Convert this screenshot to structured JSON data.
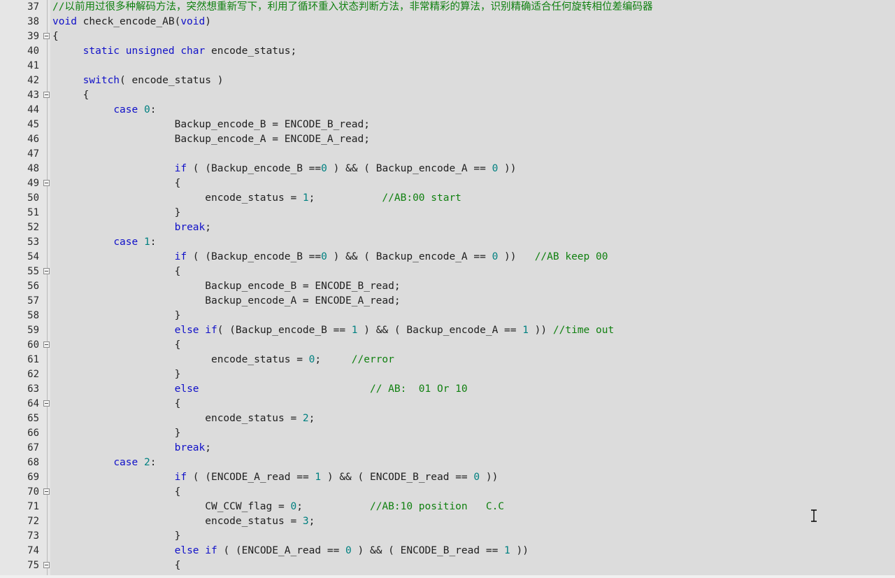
{
  "editor": {
    "lines": [
      {
        "num": "37",
        "fold": false,
        "tokens": [
          {
            "t": "//以前用过很多种解码方法，突然想重新写下，利用了循环重入状态判断方法，非常精彩的算法，识别精确适合任何旋转相位差编码器",
            "c": "cmt"
          }
        ]
      },
      {
        "num": "38",
        "fold": false,
        "tokens": [
          {
            "t": "void",
            "c": "kw"
          },
          {
            "t": " check_encode_AB(",
            "c": "plain"
          },
          {
            "t": "void",
            "c": "kw"
          },
          {
            "t": ")",
            "c": "plain"
          }
        ]
      },
      {
        "num": "39",
        "fold": true,
        "tokens": [
          {
            "t": "{",
            "c": "plain"
          }
        ]
      },
      {
        "num": "40",
        "fold": false,
        "tokens": [
          {
            "t": "     ",
            "c": "plain"
          },
          {
            "t": "static unsigned char",
            "c": "kw"
          },
          {
            "t": " encode_status;",
            "c": "plain"
          }
        ]
      },
      {
        "num": "41",
        "fold": false,
        "tokens": []
      },
      {
        "num": "42",
        "fold": false,
        "tokens": [
          {
            "t": "     ",
            "c": "plain"
          },
          {
            "t": "switch",
            "c": "kw"
          },
          {
            "t": "( encode_status )",
            "c": "plain"
          }
        ]
      },
      {
        "num": "43",
        "fold": true,
        "tokens": [
          {
            "t": "     {",
            "c": "plain"
          }
        ]
      },
      {
        "num": "44",
        "fold": false,
        "tokens": [
          {
            "t": "          ",
            "c": "plain"
          },
          {
            "t": "case",
            "c": "kw"
          },
          {
            "t": " ",
            "c": "plain"
          },
          {
            "t": "0",
            "c": "num"
          },
          {
            "t": ":",
            "c": "plain"
          }
        ]
      },
      {
        "num": "45",
        "fold": false,
        "tokens": [
          {
            "t": "                    Backup_encode_B = ENCODE_B_read;",
            "c": "plain"
          }
        ]
      },
      {
        "num": "46",
        "fold": false,
        "tokens": [
          {
            "t": "                    Backup_encode_A = ENCODE_A_read;",
            "c": "plain"
          }
        ]
      },
      {
        "num": "47",
        "fold": false,
        "tokens": []
      },
      {
        "num": "48",
        "fold": false,
        "tokens": [
          {
            "t": "                    ",
            "c": "plain"
          },
          {
            "t": "if",
            "c": "kw"
          },
          {
            "t": " ( (Backup_encode_B ==",
            "c": "plain"
          },
          {
            "t": "0",
            "c": "num"
          },
          {
            "t": " ) && ( Backup_encode_A == ",
            "c": "plain"
          },
          {
            "t": "0",
            "c": "num"
          },
          {
            "t": " ))",
            "c": "plain"
          }
        ]
      },
      {
        "num": "49",
        "fold": true,
        "tokens": [
          {
            "t": "                    {",
            "c": "plain"
          }
        ]
      },
      {
        "num": "50",
        "fold": false,
        "tokens": [
          {
            "t": "                         encode_status = ",
            "c": "plain"
          },
          {
            "t": "1",
            "c": "num"
          },
          {
            "t": ";           ",
            "c": "plain"
          },
          {
            "t": "//AB:00 start",
            "c": "cmt"
          }
        ]
      },
      {
        "num": "51",
        "fold": false,
        "tokens": [
          {
            "t": "                    }",
            "c": "plain"
          }
        ]
      },
      {
        "num": "52",
        "fold": false,
        "tokens": [
          {
            "t": "                    ",
            "c": "plain"
          },
          {
            "t": "break",
            "c": "kw"
          },
          {
            "t": ";",
            "c": "plain"
          }
        ]
      },
      {
        "num": "53",
        "fold": false,
        "tokens": [
          {
            "t": "          ",
            "c": "plain"
          },
          {
            "t": "case",
            "c": "kw"
          },
          {
            "t": " ",
            "c": "plain"
          },
          {
            "t": "1",
            "c": "num"
          },
          {
            "t": ":",
            "c": "plain"
          }
        ]
      },
      {
        "num": "54",
        "fold": false,
        "tokens": [
          {
            "t": "                    ",
            "c": "plain"
          },
          {
            "t": "if",
            "c": "kw"
          },
          {
            "t": " ( (Backup_encode_B ==",
            "c": "plain"
          },
          {
            "t": "0",
            "c": "num"
          },
          {
            "t": " ) && ( Backup_encode_A == ",
            "c": "plain"
          },
          {
            "t": "0",
            "c": "num"
          },
          {
            "t": " ))   ",
            "c": "plain"
          },
          {
            "t": "//AB keep 00",
            "c": "cmt"
          }
        ]
      },
      {
        "num": "55",
        "fold": true,
        "tokens": [
          {
            "t": "                    {",
            "c": "plain"
          }
        ]
      },
      {
        "num": "56",
        "fold": false,
        "tokens": [
          {
            "t": "                         Backup_encode_B = ENCODE_B_read;",
            "c": "plain"
          }
        ]
      },
      {
        "num": "57",
        "fold": false,
        "tokens": [
          {
            "t": "                         Backup_encode_A = ENCODE_A_read;",
            "c": "plain"
          }
        ]
      },
      {
        "num": "58",
        "fold": false,
        "tokens": [
          {
            "t": "                    }",
            "c": "plain"
          }
        ]
      },
      {
        "num": "59",
        "fold": false,
        "tokens": [
          {
            "t": "                    ",
            "c": "plain"
          },
          {
            "t": "else if",
            "c": "kw"
          },
          {
            "t": "( (Backup_encode_B == ",
            "c": "plain"
          },
          {
            "t": "1",
            "c": "num"
          },
          {
            "t": " ) && ( Backup_encode_A == ",
            "c": "plain"
          },
          {
            "t": "1",
            "c": "num"
          },
          {
            "t": " )) ",
            "c": "plain"
          },
          {
            "t": "//time out",
            "c": "cmt"
          }
        ]
      },
      {
        "num": "60",
        "fold": true,
        "tokens": [
          {
            "t": "                    {",
            "c": "plain"
          }
        ]
      },
      {
        "num": "61",
        "fold": false,
        "tokens": [
          {
            "t": "                          encode_status = ",
            "c": "plain"
          },
          {
            "t": "0",
            "c": "num"
          },
          {
            "t": ";     ",
            "c": "plain"
          },
          {
            "t": "//error",
            "c": "cmt"
          }
        ]
      },
      {
        "num": "62",
        "fold": false,
        "tokens": [
          {
            "t": "                    }",
            "c": "plain"
          }
        ]
      },
      {
        "num": "63",
        "fold": false,
        "tokens": [
          {
            "t": "                    ",
            "c": "plain"
          },
          {
            "t": "else",
            "c": "kw"
          },
          {
            "t": "                            ",
            "c": "plain"
          },
          {
            "t": "// AB:  01 Or 10",
            "c": "cmt"
          }
        ]
      },
      {
        "num": "64",
        "fold": true,
        "tokens": [
          {
            "t": "                    {",
            "c": "plain"
          }
        ]
      },
      {
        "num": "65",
        "fold": false,
        "tokens": [
          {
            "t": "                         encode_status = ",
            "c": "plain"
          },
          {
            "t": "2",
            "c": "num"
          },
          {
            "t": ";",
            "c": "plain"
          }
        ]
      },
      {
        "num": "66",
        "fold": false,
        "tokens": [
          {
            "t": "                    }",
            "c": "plain"
          }
        ]
      },
      {
        "num": "67",
        "fold": false,
        "tokens": [
          {
            "t": "                    ",
            "c": "plain"
          },
          {
            "t": "break",
            "c": "kw"
          },
          {
            "t": ";",
            "c": "plain"
          }
        ]
      },
      {
        "num": "68",
        "fold": false,
        "tokens": [
          {
            "t": "          ",
            "c": "plain"
          },
          {
            "t": "case",
            "c": "kw"
          },
          {
            "t": " ",
            "c": "plain"
          },
          {
            "t": "2",
            "c": "num"
          },
          {
            "t": ":",
            "c": "plain"
          }
        ]
      },
      {
        "num": "69",
        "fold": false,
        "tokens": [
          {
            "t": "                    ",
            "c": "plain"
          },
          {
            "t": "if",
            "c": "kw"
          },
          {
            "t": " ( (ENCODE_A_read == ",
            "c": "plain"
          },
          {
            "t": "1",
            "c": "num"
          },
          {
            "t": " ) && ( ENCODE_B_read == ",
            "c": "plain"
          },
          {
            "t": "0",
            "c": "num"
          },
          {
            "t": " ))",
            "c": "plain"
          }
        ]
      },
      {
        "num": "70",
        "fold": true,
        "tokens": [
          {
            "t": "                    {",
            "c": "plain"
          }
        ]
      },
      {
        "num": "71",
        "fold": false,
        "tokens": [
          {
            "t": "                         CW_CCW_flag = ",
            "c": "plain"
          },
          {
            "t": "0",
            "c": "num"
          },
          {
            "t": ";           ",
            "c": "plain"
          },
          {
            "t": "//AB:10 position   C.C",
            "c": "cmt"
          }
        ]
      },
      {
        "num": "72",
        "fold": false,
        "tokens": [
          {
            "t": "                         encode_status = ",
            "c": "plain"
          },
          {
            "t": "3",
            "c": "num"
          },
          {
            "t": ";",
            "c": "plain"
          }
        ]
      },
      {
        "num": "73",
        "fold": false,
        "tokens": [
          {
            "t": "                    }",
            "c": "plain"
          }
        ]
      },
      {
        "num": "74",
        "fold": false,
        "tokens": [
          {
            "t": "                    ",
            "c": "plain"
          },
          {
            "t": "else if",
            "c": "kw"
          },
          {
            "t": " ( (ENCODE_A_read == ",
            "c": "plain"
          },
          {
            "t": "0",
            "c": "num"
          },
          {
            "t": " ) && ( ENCODE_B_read == ",
            "c": "plain"
          },
          {
            "t": "1",
            "c": "num"
          },
          {
            "t": " ))",
            "c": "plain"
          }
        ]
      },
      {
        "num": "75",
        "fold": true,
        "tokens": [
          {
            "t": "                    {",
            "c": "plain"
          }
        ]
      }
    ]
  },
  "colors": {
    "keyword": "#1010c8",
    "number": "#008080",
    "comment": "#108010",
    "text": "#202020",
    "background": "#dcdcdc"
  }
}
